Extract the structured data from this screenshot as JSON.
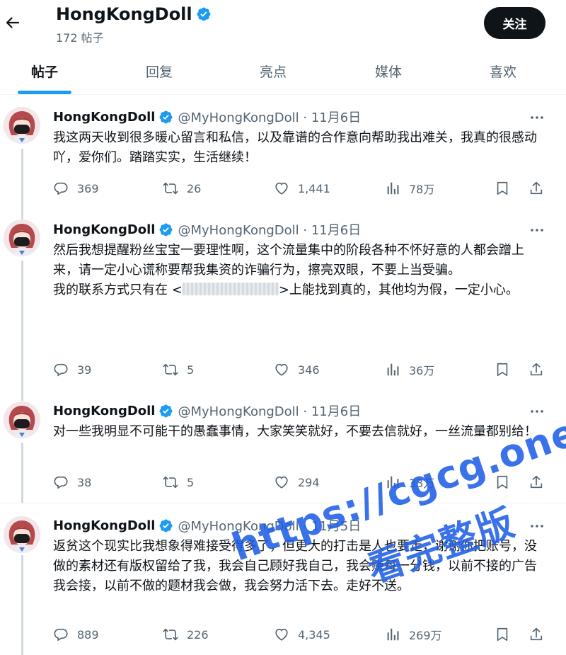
{
  "header": {
    "name": "HongKongDoll",
    "post_count": "172 帖子",
    "follow_label": "关注"
  },
  "tabs": [
    "帖子",
    "回复",
    "亮点",
    "媒体",
    "喜欢"
  ],
  "active_tab": 0,
  "posts": [
    {
      "name": "HongKongDoll",
      "meta": "@MyHongKongDoll · 11月6日",
      "text": "我这两天收到很多暖心留言和私信，以及靠谱的合作意向帮助我出难关，我真的很感动吖，爱你们。踏踏实实，生活继续！",
      "replies": "369",
      "reposts": "26",
      "likes": "1,441",
      "views": "78万"
    },
    {
      "name": "HongKongDoll",
      "meta": "@MyHongKongDoll · 11月6日",
      "text": "然后我想提醒粉丝宝宝一要理性啊，这个流量集中的阶段各种不怀好意的人都会蹭上来，请一定小心谎称要帮我集资的诈骗行为，擦亮双眼，不要上当受骗。",
      "text2_pre": "我的联系方式只有在 <",
      "text2_post": ">上能找到真的，其他均为假，一定小心。",
      "replies": "39",
      "reposts": "5",
      "likes": "346",
      "views": "36万"
    },
    {
      "name": "HongKongDoll",
      "meta": "@MyHongKongDoll · 11月6日",
      "text": "对一些我明显不可能干的愚蠢事情，大家笑笑就好，不要去信就好，一丝流量都别给！",
      "replies": "38",
      "reposts": "5",
      "likes": "294",
      "views": "33万"
    },
    {
      "name": "HongKongDoll",
      "meta": "@MyHongKongDoll · 11月5日",
      "text": "返贫这个现实比我想象得难接受得多了，但更大的打击是人也要走，谢谢你把账号，没做的素材还有版权留给了我，我会自己顾好我自己，我会赚每一分钱，以前不接的广告我会接，以前不做的题材我会做，我会努力活下去。走好不送。",
      "replies": "889",
      "reposts": "226",
      "likes": "4,345",
      "views": "269万"
    }
  ],
  "watermark": {
    "line1": "https://cgcg.one",
    "line2": "看完整版"
  },
  "colors": {
    "accent": "#1d9bf0",
    "text": "#0f1419",
    "muted": "#536471",
    "watermark": "#1f5fe6"
  },
  "icons": [
    "back-arrow-icon",
    "verified-badge-icon",
    "more-icon",
    "reply-icon",
    "repost-icon",
    "like-icon",
    "views-icon",
    "bookmark-icon",
    "share-icon"
  ]
}
